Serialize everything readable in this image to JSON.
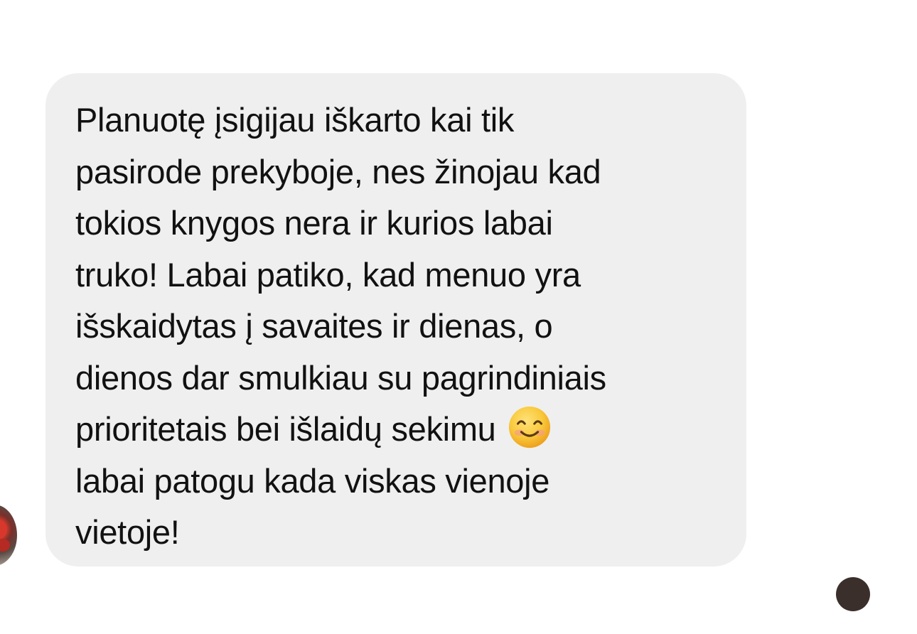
{
  "message": {
    "lines_before_emoji": [
      "Planuotę įsigijau iškarto kai tik",
      "pasirode prekyboje, nes žinojau kad",
      "tokios knygos nera ir kurios labai",
      "truko! Labai patiko, kad menuo yra",
      "išskaidytas į savaites ir dienas, o",
      "dienos dar smulkiau su pagrindiniais"
    ],
    "emoji_line_text": "prioritetais bei išlaidų sekimu ",
    "emoji": "smiling-face-with-smiling-eyes-emoji",
    "lines_after_emoji": [
      "labai patogu kada viskas vienoje",
      "vietoje!"
    ]
  },
  "colors": {
    "bubble_background": "#efefef",
    "text": "#111111",
    "emoji_face": "#f7c23a"
  }
}
